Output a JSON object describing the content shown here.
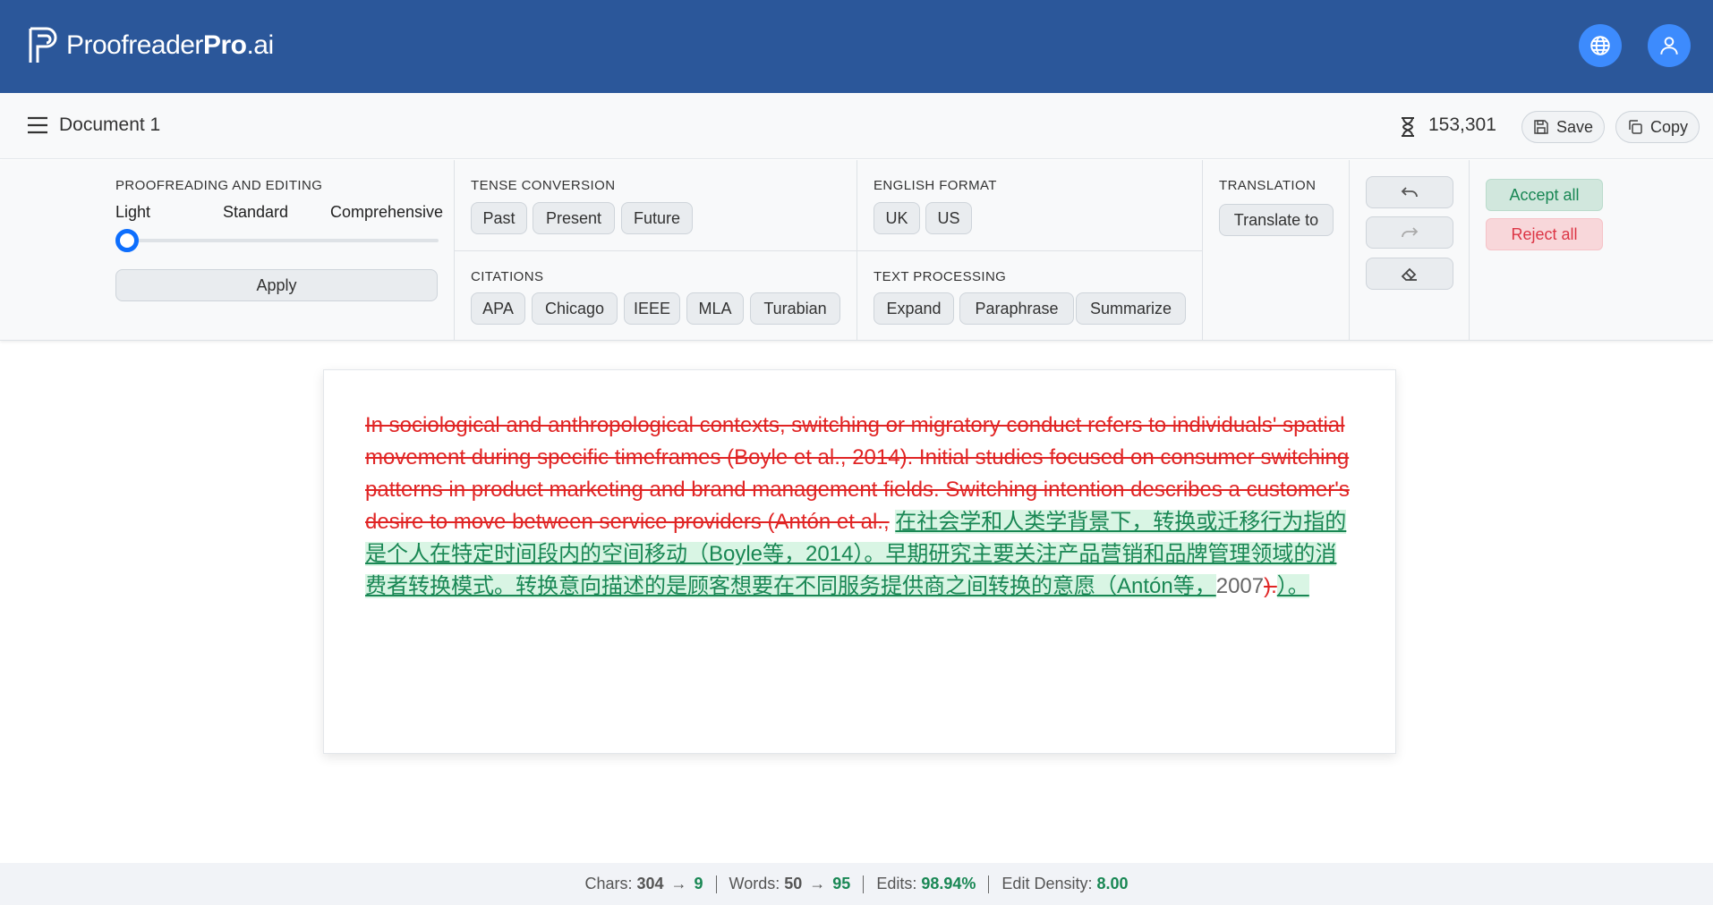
{
  "header": {
    "logo_part1": "Proofreader",
    "logo_part2": "Pro",
    "logo_part3": ".ai",
    "icons": [
      "globe-icon",
      "user-icon"
    ]
  },
  "docbar": {
    "title": "Document 1",
    "counter": "153,301",
    "save_label": "Save",
    "copy_label": "Copy"
  },
  "toolbar": {
    "proofreading": {
      "label": "PROOFREADING AND EDITING",
      "levels": [
        "Light",
        "Standard",
        "Comprehensive"
      ],
      "selected_level": "Light",
      "apply_label": "Apply"
    },
    "tense": {
      "label": "TENSE CONVERSION",
      "options": [
        "Past",
        "Present",
        "Future"
      ]
    },
    "citations": {
      "label": "CITATIONS",
      "options": [
        "APA",
        "Chicago",
        "IEEE",
        "MLA",
        "Turabian"
      ]
    },
    "english": {
      "label": "ENGLISH FORMAT",
      "options": [
        "UK",
        "US"
      ]
    },
    "processing": {
      "label": "TEXT PROCESSING",
      "options": [
        "Expand",
        "Paraphrase",
        "Summarize"
      ]
    },
    "translation": {
      "label": "TRANSLATION",
      "button": "Translate to"
    },
    "accept_all": "Accept all",
    "reject_all": "Reject all"
  },
  "editor": {
    "deleted_text": "In sociological and anthropological contexts, switching or migratory conduct refers to individuals' spatial movement during specific timeframes (Boyle et al., 2014). Initial studies focused on consumer switching patterns in product marketing and brand management fields. Switching intention describes a customer's desire to move between service providers (Antón et al.,",
    "inserted_text": "在社会学和人类学背景下，转换或迁移行为指的是个人在特定时间段内的空间移动（Boyle等，2014）。早期研究主要关注产品营销和品牌管理领域的消费者转换模式。转换意向描述的是顾客想要在不同服务提供商之间转换的意愿（Antón等，",
    "kept_text": "2007",
    "deleted_tail": ").",
    "inserted_tail": "）。"
  },
  "status": {
    "chars_label": "Chars:",
    "chars_from": "304",
    "chars_to": "9",
    "words_label": "Words:",
    "words_from": "50",
    "words_to": "95",
    "edits_label": "Edits:",
    "edits_value": "98.94%",
    "density_label": "Edit Density:",
    "density_value": "8.00"
  }
}
